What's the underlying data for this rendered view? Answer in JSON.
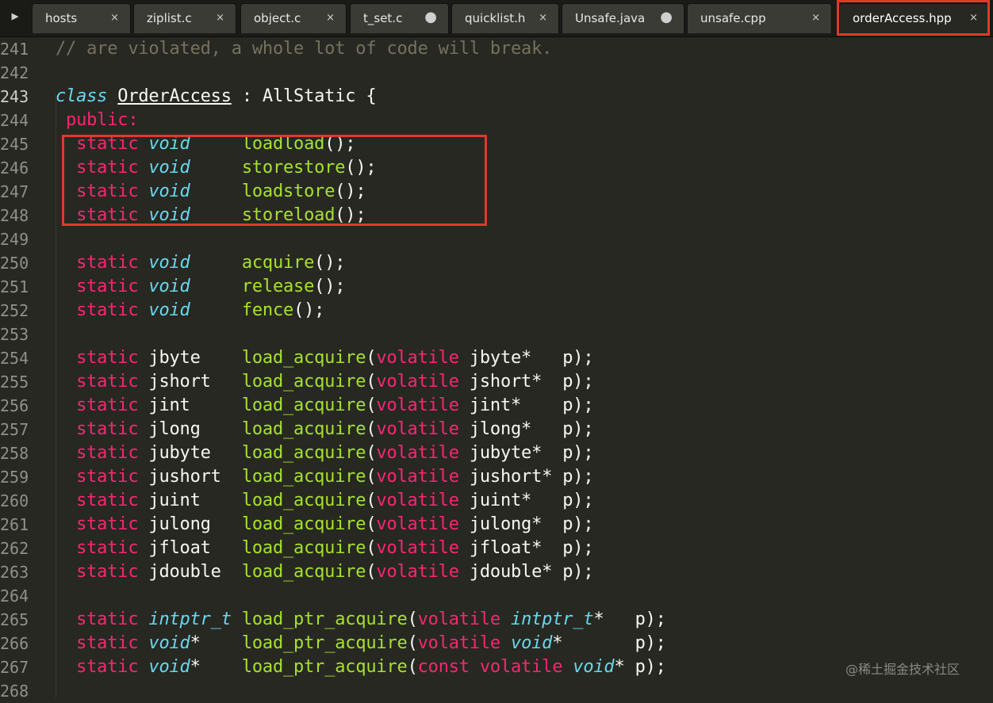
{
  "nav_arrow": "▶",
  "tabs": [
    {
      "title": "hosts",
      "close": "×",
      "dirty": false,
      "active": false
    },
    {
      "title": "ziplist.c",
      "close": "×",
      "dirty": false,
      "active": false
    },
    {
      "title": "object.c",
      "close": "×",
      "dirty": false,
      "active": false
    },
    {
      "title": "t_set.c",
      "close": "●",
      "dirty": true,
      "active": false
    },
    {
      "title": "quicklist.h",
      "close": "×",
      "dirty": false,
      "active": false
    },
    {
      "title": "Unsafe.java",
      "close": "●",
      "dirty": true,
      "active": false
    },
    {
      "title": "unsafe.cpp",
      "close": "×",
      "dirty": false,
      "active": false
    },
    {
      "title": "orderAccess.hpp",
      "close": "×",
      "dirty": false,
      "active": true
    }
  ],
  "editor": {
    "current_line": "243",
    "lines": [
      {
        "num": "241",
        "tokens": [
          [
            "comment",
            "// are violated, a whole lot of code will break."
          ]
        ]
      },
      {
        "num": "242",
        "tokens": []
      },
      {
        "num": "243",
        "tokens": [
          [
            "storage",
            "class"
          ],
          [
            "plain",
            " "
          ],
          [
            "class",
            "OrderAccess"
          ],
          [
            "plain",
            " : AllStatic {"
          ]
        ]
      },
      {
        "num": "244",
        "tokens": [
          [
            "keyword",
            " public:"
          ]
        ]
      },
      {
        "num": "245",
        "tokens": [
          [
            "keyword",
            "  static "
          ],
          [
            "storage",
            "void"
          ],
          [
            "plain",
            "     "
          ],
          [
            "func",
            "loadload"
          ],
          [
            "plain",
            "();"
          ]
        ]
      },
      {
        "num": "246",
        "tokens": [
          [
            "keyword",
            "  static "
          ],
          [
            "storage",
            "void"
          ],
          [
            "plain",
            "     "
          ],
          [
            "func",
            "storestore"
          ],
          [
            "plain",
            "();"
          ]
        ]
      },
      {
        "num": "247",
        "tokens": [
          [
            "keyword",
            "  static "
          ],
          [
            "storage",
            "void"
          ],
          [
            "plain",
            "     "
          ],
          [
            "func",
            "loadstore"
          ],
          [
            "plain",
            "();"
          ]
        ]
      },
      {
        "num": "248",
        "tokens": [
          [
            "keyword",
            "  static "
          ],
          [
            "storage",
            "void"
          ],
          [
            "plain",
            "     "
          ],
          [
            "func",
            "storeload"
          ],
          [
            "plain",
            "();"
          ]
        ]
      },
      {
        "num": "249",
        "tokens": []
      },
      {
        "num": "250",
        "tokens": [
          [
            "keyword",
            "  static "
          ],
          [
            "storage",
            "void"
          ],
          [
            "plain",
            "     "
          ],
          [
            "func",
            "acquire"
          ],
          [
            "plain",
            "();"
          ]
        ]
      },
      {
        "num": "251",
        "tokens": [
          [
            "keyword",
            "  static "
          ],
          [
            "storage",
            "void"
          ],
          [
            "plain",
            "     "
          ],
          [
            "func",
            "release"
          ],
          [
            "plain",
            "();"
          ]
        ]
      },
      {
        "num": "252",
        "tokens": [
          [
            "keyword",
            "  static "
          ],
          [
            "storage",
            "void"
          ],
          [
            "plain",
            "     "
          ],
          [
            "func",
            "fence"
          ],
          [
            "plain",
            "();"
          ]
        ]
      },
      {
        "num": "253",
        "tokens": []
      },
      {
        "num": "254",
        "tokens": [
          [
            "keyword",
            "  static "
          ],
          [
            "plain",
            "jbyte    "
          ],
          [
            "func",
            "load_acquire"
          ],
          [
            "plain",
            "("
          ],
          [
            "keyword",
            "volatile"
          ],
          [
            "plain",
            " jbyte*   p);"
          ]
        ]
      },
      {
        "num": "255",
        "tokens": [
          [
            "keyword",
            "  static "
          ],
          [
            "plain",
            "jshort   "
          ],
          [
            "func",
            "load_acquire"
          ],
          [
            "plain",
            "("
          ],
          [
            "keyword",
            "volatile"
          ],
          [
            "plain",
            " jshort*  p);"
          ]
        ]
      },
      {
        "num": "256",
        "tokens": [
          [
            "keyword",
            "  static "
          ],
          [
            "plain",
            "jint     "
          ],
          [
            "func",
            "load_acquire"
          ],
          [
            "plain",
            "("
          ],
          [
            "keyword",
            "volatile"
          ],
          [
            "plain",
            " jint*    p);"
          ]
        ]
      },
      {
        "num": "257",
        "tokens": [
          [
            "keyword",
            "  static "
          ],
          [
            "plain",
            "jlong    "
          ],
          [
            "func",
            "load_acquire"
          ],
          [
            "plain",
            "("
          ],
          [
            "keyword",
            "volatile"
          ],
          [
            "plain",
            " jlong*   p);"
          ]
        ]
      },
      {
        "num": "258",
        "tokens": [
          [
            "keyword",
            "  static "
          ],
          [
            "plain",
            "jubyte   "
          ],
          [
            "func",
            "load_acquire"
          ],
          [
            "plain",
            "("
          ],
          [
            "keyword",
            "volatile"
          ],
          [
            "plain",
            " jubyte*  p);"
          ]
        ]
      },
      {
        "num": "259",
        "tokens": [
          [
            "keyword",
            "  static "
          ],
          [
            "plain",
            "jushort  "
          ],
          [
            "func",
            "load_acquire"
          ],
          [
            "plain",
            "("
          ],
          [
            "keyword",
            "volatile"
          ],
          [
            "plain",
            " jushort* p);"
          ]
        ]
      },
      {
        "num": "260",
        "tokens": [
          [
            "keyword",
            "  static "
          ],
          [
            "plain",
            "juint    "
          ],
          [
            "func",
            "load_acquire"
          ],
          [
            "plain",
            "("
          ],
          [
            "keyword",
            "volatile"
          ],
          [
            "plain",
            " juint*   p);"
          ]
        ]
      },
      {
        "num": "261",
        "tokens": [
          [
            "keyword",
            "  static "
          ],
          [
            "plain",
            "julong   "
          ],
          [
            "func",
            "load_acquire"
          ],
          [
            "plain",
            "("
          ],
          [
            "keyword",
            "volatile"
          ],
          [
            "plain",
            " julong*  p);"
          ]
        ]
      },
      {
        "num": "262",
        "tokens": [
          [
            "keyword",
            "  static "
          ],
          [
            "plain",
            "jfloat   "
          ],
          [
            "func",
            "load_acquire"
          ],
          [
            "plain",
            "("
          ],
          [
            "keyword",
            "volatile"
          ],
          [
            "plain",
            " jfloat*  p);"
          ]
        ]
      },
      {
        "num": "263",
        "tokens": [
          [
            "keyword",
            "  static "
          ],
          [
            "plain",
            "jdouble  "
          ],
          [
            "func",
            "load_acquire"
          ],
          [
            "plain",
            "("
          ],
          [
            "keyword",
            "volatile"
          ],
          [
            "plain",
            " jdouble* p);"
          ]
        ]
      },
      {
        "num": "264",
        "tokens": []
      },
      {
        "num": "265",
        "tokens": [
          [
            "keyword",
            "  static "
          ],
          [
            "storage",
            "intptr_t"
          ],
          [
            "plain",
            " "
          ],
          [
            "func",
            "load_ptr_acquire"
          ],
          [
            "plain",
            "("
          ],
          [
            "keyword",
            "volatile"
          ],
          [
            "plain",
            " "
          ],
          [
            "storage",
            "intptr_t"
          ],
          [
            "plain",
            "*   p);"
          ]
        ]
      },
      {
        "num": "266",
        "tokens": [
          [
            "keyword",
            "  static "
          ],
          [
            "storage",
            "void"
          ],
          [
            "plain",
            "*    "
          ],
          [
            "func",
            "load_ptr_acquire"
          ],
          [
            "plain",
            "("
          ],
          [
            "keyword",
            "volatile"
          ],
          [
            "plain",
            " "
          ],
          [
            "storage",
            "void"
          ],
          [
            "plain",
            "*       p);"
          ]
        ]
      },
      {
        "num": "267",
        "tokens": [
          [
            "keyword",
            "  static "
          ],
          [
            "storage",
            "void"
          ],
          [
            "plain",
            "*    "
          ],
          [
            "func",
            "load_ptr_acquire"
          ],
          [
            "plain",
            "("
          ],
          [
            "keyword",
            "const volatile"
          ],
          [
            "plain",
            " "
          ],
          [
            "storage",
            "void"
          ],
          [
            "plain",
            "* p);"
          ]
        ]
      },
      {
        "num": "268",
        "tokens": []
      }
    ]
  },
  "watermark": "@稀土掘金技术社区",
  "colors": {
    "background": "#272822",
    "comment": "#75715e",
    "keyword": "#f92672",
    "storage": "#66d9ef",
    "function": "#a6e22e",
    "plain": "#f8f8f2",
    "highlight_box": "#e0392b"
  }
}
